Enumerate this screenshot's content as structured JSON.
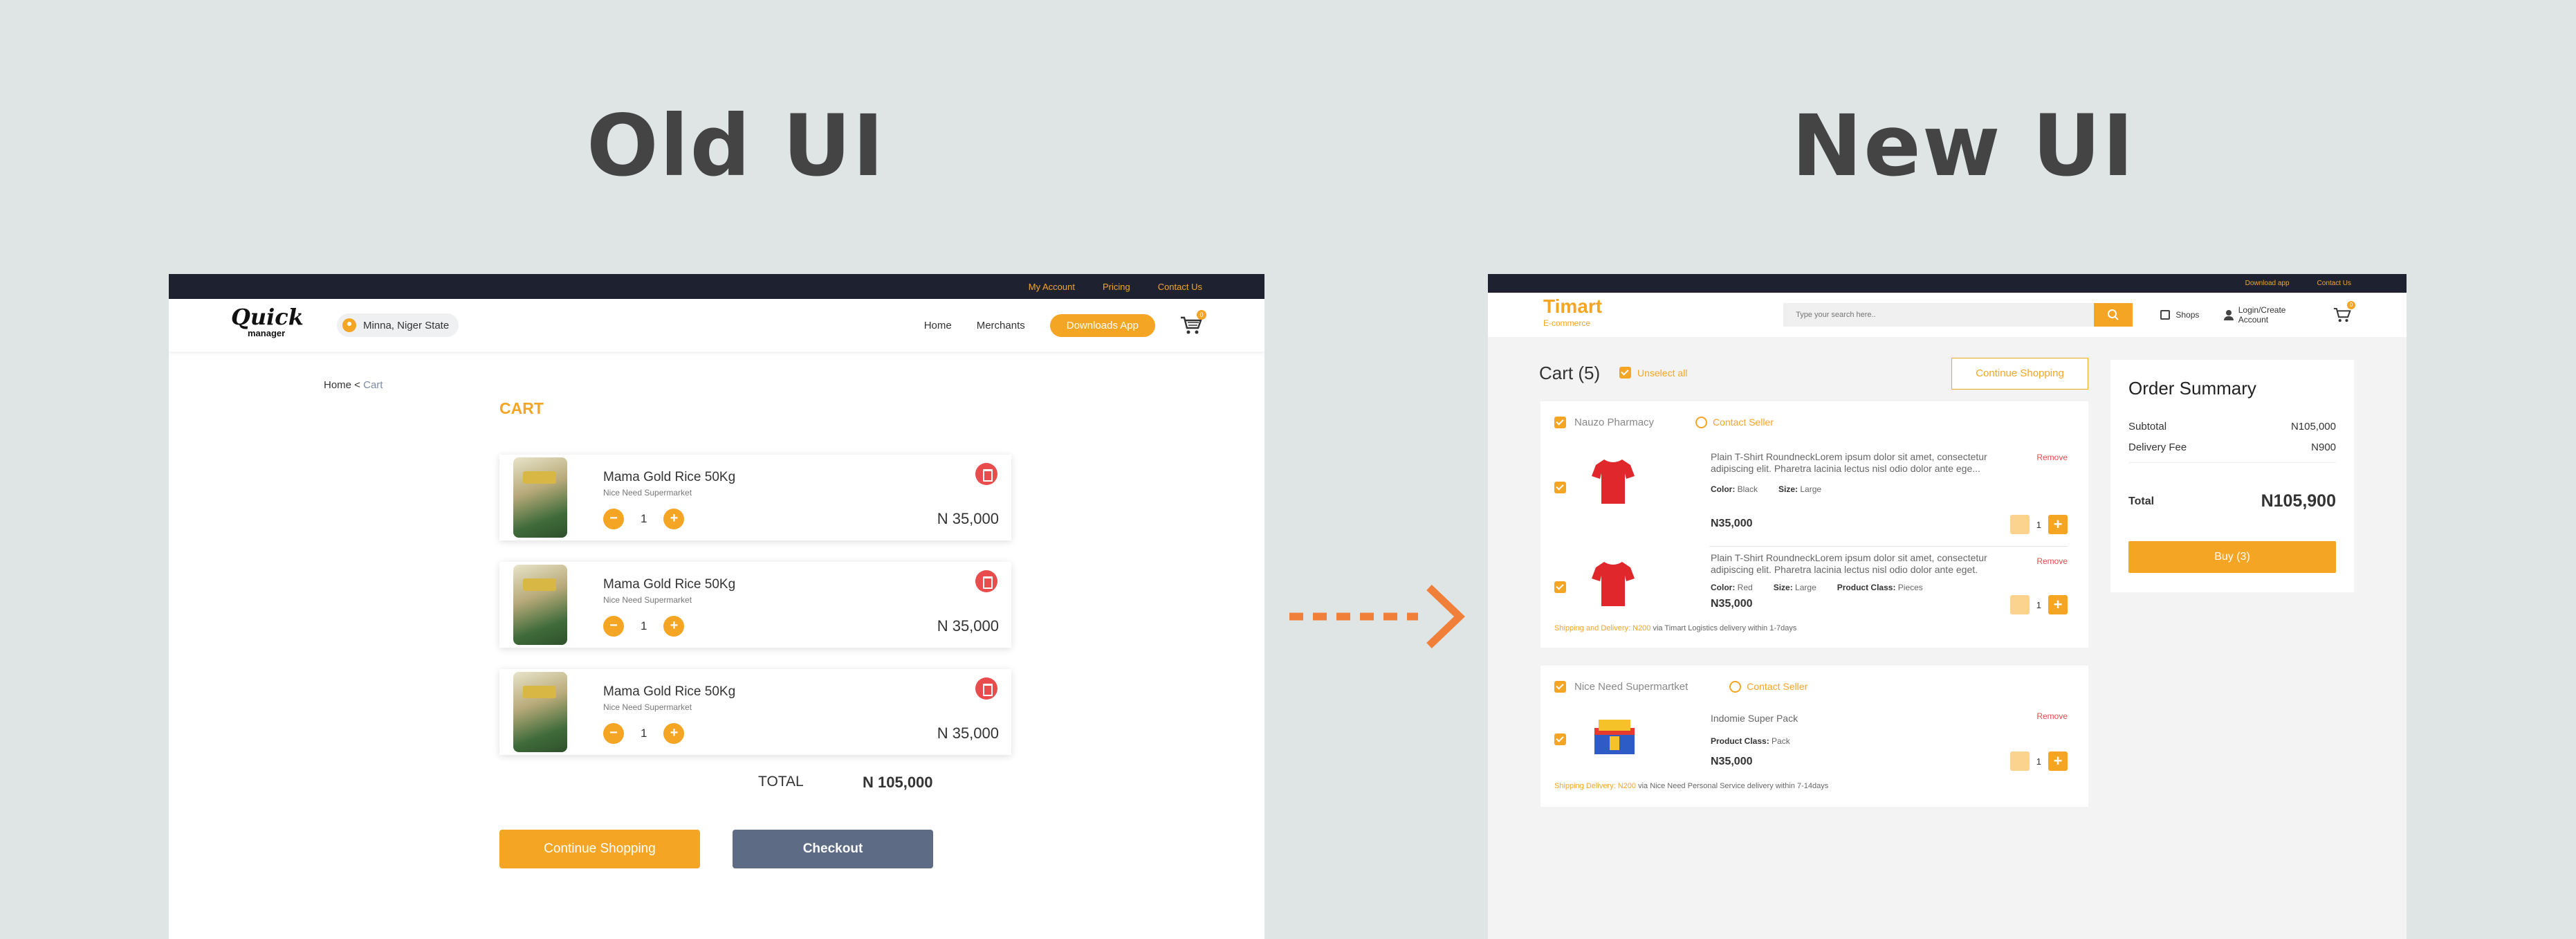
{
  "labels": {
    "old": "Old UI",
    "new": "New UI"
  },
  "old_ui": {
    "top_links": [
      "My Account",
      "Pricing",
      "Contact Us"
    ],
    "logo": "Quick",
    "logo_sub": "manager",
    "location": "Minna, Niger State",
    "nav": [
      "Home",
      "Merchants"
    ],
    "download_label": "Downloads App",
    "cart_count": "0",
    "breadcrumb": {
      "home": "Home <",
      "current": "Cart"
    },
    "cart_title": "CART",
    "items": [
      {
        "name": "Mama Gold Rice 50Kg",
        "store": "Nice Need Supermarket",
        "qty": "1",
        "price": "N 35,000"
      },
      {
        "name": "Mama Gold Rice 50Kg",
        "store": "Nice Need Supermarket",
        "qty": "1",
        "price": "N 35,000"
      },
      {
        "name": "Mama Gold Rice 50Kg",
        "store": "Nice Need Supermarket",
        "qty": "1",
        "price": "N 35,000"
      }
    ],
    "minus": "−",
    "plus": "+",
    "total_label": "TOTAL",
    "total_value": "N 105,000",
    "continue_label": "Continue Shopping",
    "checkout_label": "Checkout"
  },
  "new_ui": {
    "top_links": [
      "Download app",
      "Contact Us"
    ],
    "logo": "Timart",
    "logo_sub": "E-commerce",
    "search_placeholder": "Type your search here..",
    "shops_label": "Shops",
    "login_label": "Login/Create Account",
    "cart_count": "0",
    "cart_heading": "Cart (5)",
    "unselect_label": "Unselect all",
    "continue_label": "Continue Shopping",
    "stores": [
      {
        "name": "Nauzo Pharmacy",
        "contact": "Contact Seller",
        "products": [
          {
            "name": "Plain T-Shirt RoundneckLorem ipsum dolor sit amet, consectetur adipiscing elit. Pharetra lacinia lectus nisl odio dolor ante ege...",
            "remove": "Remove",
            "color_label": "Color:",
            "color": "Black",
            "size_label": "Size:",
            "size": "Large",
            "price": "N35,000",
            "qty": "1"
          },
          {
            "name": "Plain T-Shirt RoundneckLorem ipsum dolor sit amet, consectetur adipiscing elit. Pharetra lacinia lectus nisl odio dolor ante eget.",
            "remove": "Remove",
            "color_label": "Color:",
            "color": "Red",
            "size_label": "Size:",
            "size": "Large",
            "class_label": "Product Class:",
            "class": "Pieces",
            "price": "N35,000",
            "qty": "1"
          }
        ],
        "shipping_hl": "Shipping and Delivery: N200",
        "shipping_rest": " via Timart Logistics delivery within 1-7days"
      },
      {
        "name": "Nice Need Supermartket",
        "contact": "Contact Seller",
        "products": [
          {
            "name": "Indomie Super Pack",
            "remove": "Remove",
            "class_label": "Product Class:",
            "class": "Pack",
            "price": "N35,000",
            "qty": "1"
          }
        ],
        "shipping_hl": "Shipping Delivery: N200",
        "shipping_rest": " via Nice Need Personal Service delivery within 7-14days"
      }
    ],
    "summary": {
      "title": "Order Summary",
      "subtotal_label": "Subtotal",
      "subtotal": "N105,000",
      "delivery_label": "Delivery Fee",
      "delivery": "N900",
      "total_label": "Total",
      "total": "N105,900",
      "buy_label": "Buy (3)"
    },
    "plus": "+"
  },
  "colors": {
    "accent": "#f5a524",
    "dark_bar": "#1e2230",
    "danger": "#e84c4c",
    "checkout": "#5d6b85",
    "arrow": "#f07f3a"
  }
}
